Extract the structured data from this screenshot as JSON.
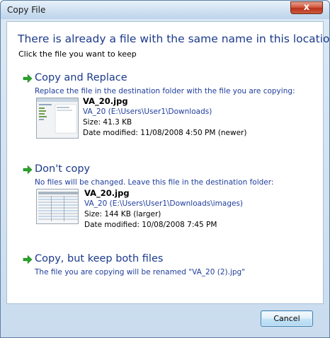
{
  "window": {
    "title": "Copy File",
    "close_label": "x"
  },
  "header": {
    "heading": "There is already a file with the same name in this location.",
    "subheading": "Click the file you want to keep"
  },
  "options": [
    {
      "title": "Copy and Replace",
      "description": "Replace the file in the destination folder with the file you are copying:",
      "file": {
        "name": "VA_20.jpg",
        "path": "VA_20 (E:\\Users\\User1\\Downloads)",
        "size": "Size: 41.3 KB",
        "date": "Date modified: 11/08/2008 4:50 PM (newer)"
      }
    },
    {
      "title": "Don't copy",
      "description": "No files will be changed. Leave this file in the destination folder:",
      "file": {
        "name": "VA_20.jpg",
        "path": "VA_20 (E:\\Users\\User1\\Downloads\\images)",
        "size": "Size: 144 KB (larger)",
        "date": "Date modified: 10/08/2008 7:45 PM"
      }
    },
    {
      "title": "Copy, but keep both files",
      "description": "The file you are copying will be renamed \"VA_20 (2).jpg\""
    }
  ],
  "footer": {
    "cancel_label": "Cancel"
  },
  "colors": {
    "accent_text": "#1b3a8c",
    "arrow_green": "#2aa52a",
    "close_red": "#c8452a"
  },
  "icons": {
    "option_arrow": "green-right-arrow-icon",
    "close": "close-icon"
  }
}
